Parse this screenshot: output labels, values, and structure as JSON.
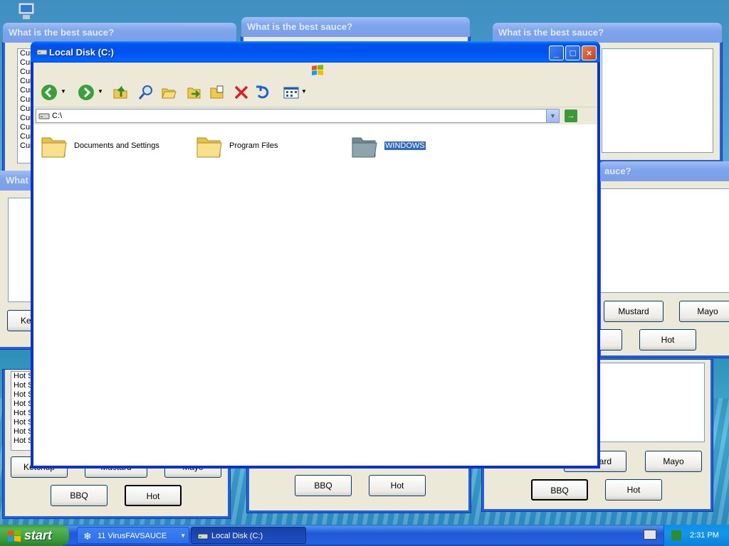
{
  "background_windows": {
    "title": "What is the best sauce?",
    "title_partial_left": "What",
    "title_partial_right": "auce?",
    "list_item_cum": "Cum",
    "list_item_hot": "Hot S",
    "btn_ketchup": "Ketchup",
    "btn_ketchup_partial": "Ke",
    "btn_mustard": "Mustard",
    "btn_mustard_partial": "ard",
    "btn_mayo": "Mayo",
    "btn_bbq": "BBQ",
    "btn_hot": "Hot"
  },
  "explorer": {
    "title": "Local Disk (C:)",
    "address": "C:\\",
    "folders": [
      {
        "name": "Documents and Settings"
      },
      {
        "name": "Program Files"
      },
      {
        "name": "WINDOWS",
        "selected": true
      }
    ]
  },
  "taskbar": {
    "start_label": "start",
    "items": [
      {
        "label": "11 VirusFAVSAUCE"
      },
      {
        "label": "Local Disk (C:)"
      }
    ],
    "clock": "2:31 PM"
  },
  "colors": {
    "titlebar_active": "#0054e3",
    "start_green": "#3a9a3a",
    "selection": "#316ac5"
  }
}
